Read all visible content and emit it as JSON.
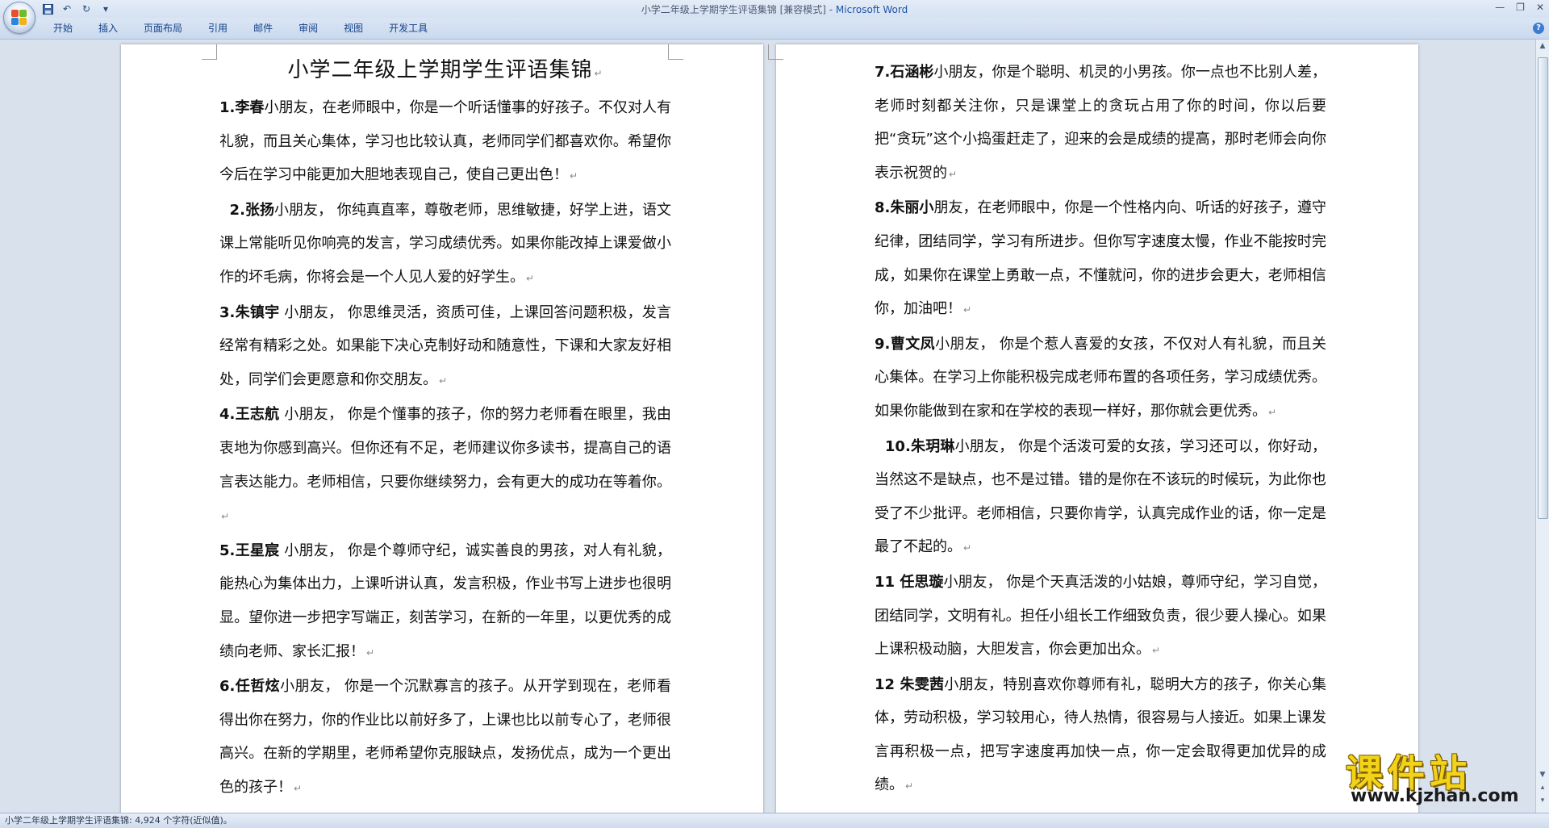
{
  "window": {
    "title_doc": "小学二年级上学期学生评语集锦 [兼容模式] - ",
    "title_app": "Microsoft Word"
  },
  "ribbon": {
    "tabs": [
      "开始",
      "插入",
      "页面布局",
      "引用",
      "邮件",
      "审阅",
      "视图",
      "开发工具"
    ]
  },
  "document": {
    "title": "小学二年级上学期学生评语集锦",
    "page1": [
      {
        "num": "1.",
        "name": "李春",
        "text": "小朋友，在老师眼中，你是一个听话懂事的好孩子。不仅对人有礼貌，而且关心集体，学习也比较认真，老师同学们都喜欢你。希望你今后在学习中能更加大胆地表现自己，使自己更出色！"
      },
      {
        "num": "  2.",
        "name": "张扬",
        "text": "小朋友， 你纯真直率，尊敬老师，思维敏捷，好学上进，语文课上常能听见你响亮的发言，学习成绩优秀。如果你能改掉上课爱做小作的坏毛病，你将会是一个人见人爱的好学生。"
      },
      {
        "num": "3.",
        "name": "朱镇宇",
        "text": " 小朋友， 你思维灵活，资质可佳，上课回答问题积极，发言经常有精彩之处。如果能下决心克制好动和随意性，下课和大家友好相处，同学们会更愿意和你交朋友。"
      },
      {
        "num": "4.",
        "name": "王志航",
        "text": " 小朋友，  你是个懂事的孩子，你的努力老师看在眼里，我由衷地为你感到高兴。但你还有不足，老师建议你多读书，提高自己的语言表达能力。老师相信，只要你继续努力，会有更大的成功在等着你。"
      },
      {
        "num": "5.",
        "name": "王星宸",
        "text": " 小朋友，  你是个尊师守纪，诚实善良的男孩，对人有礼貌，能热心为集体出力，上课听讲认真，发言积极，作业书写上进步也很明显。望你进一步把字写端正，刻苦学习，在新的一年里，以更优秀的成绩向老师、家长汇报！"
      },
      {
        "num": "6.",
        "name": "任哲炫",
        "text": "小朋友， 你是一个沉默寡言的孩子。从开学到现在，老师看得出你在努力，你的作业比以前好多了，上课也比以前专心了，老师很高兴。在新的学期里，老师希望你克服缺点，发扬优点，成为一个更出色的孩子！"
      }
    ],
    "page2": [
      {
        "num": "7.",
        "name": "石涵彬",
        "text": "小朋友，你是个聪明、机灵的小男孩。你一点也不比别人差，老师时刻都关注你，只是课堂上的贪玩占用了你的时间，你以后要把“贪玩”这个小捣蛋赶走了，迎来的会是成绩的提高，那时老师会向你表示祝贺的"
      },
      {
        "num": "8.",
        "name": "朱丽小",
        "text": "朋友，在老师眼中，你是一个性格内向、听话的好孩子，遵守纪律，团结同学，学习有所进步。但你写字速度太慢，作业不能按时完成，如果你在课堂上勇敢一点，不懂就问，你的进步会更大，老师相信你，加油吧！"
      },
      {
        "num": "9.",
        "name": "曹文凤",
        "text": "小朋友， 你是个惹人喜爱的女孩，不仅对人有礼貌，而且关心集体。在学习上你能积极完成老师布置的各项任务，学习成绩优秀。如果你能做到在家和在学校的表现一样好，那你就会更优秀。"
      },
      {
        "num": "  10.",
        "name": "朱玥琳",
        "text": "小朋友，  你是个活泼可爱的女孩，学习还可以，你好动，当然这不是缺点，也不是过错。错的是你在不该玩的时候玩，为此你也受了不少批评。老师相信，只要你肯学，认真完成作业的话，你一定是最了不起的。"
      },
      {
        "num": "11 ",
        "name": "任思璇",
        "text": "小朋友，  你是个天真活泼的小姑娘，尊师守纪，学习自觉，团结同学，文明有礼。担任小组长工作细致负责，很少要人操心。如果上课积极动脑，大胆发言，你会更加出众。"
      },
      {
        "num": "12 ",
        "name": "朱雯茜",
        "text": "小朋友，特别喜欢你尊师有礼，聪明大方的孩子，你关心集体，劳动积极，学习较用心，待人热情，很容易与人接近。如果上课发言再积极一点，把写字速度再加快一点，你一定会取得更加优异的成绩。"
      }
    ]
  },
  "statusbar": {
    "text": "小学二年级上学期学生评语集锦: 4,924 个字符(近似值)。"
  },
  "watermark": {
    "main": "课件站",
    "sub": "www.kjzhan.com"
  }
}
